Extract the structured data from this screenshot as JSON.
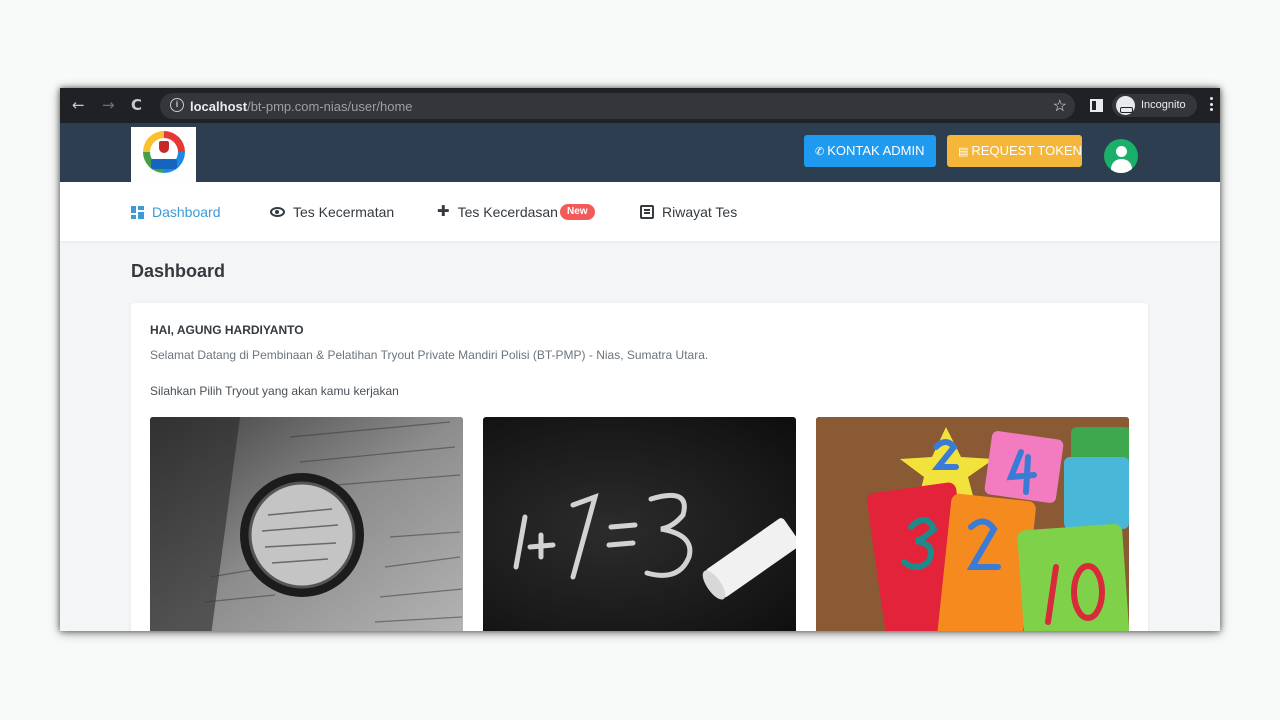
{
  "browser": {
    "back_icon": "arrow-left-icon",
    "forward_icon": "arrow-right-icon",
    "reload_icon": "reload-icon",
    "url_host": "localhost",
    "url_path": "/bt-pmp.com-nias/user/home",
    "mode_label": "Incognito"
  },
  "header": {
    "contact_admin_label": "KONTAK ADMIN",
    "request_token_label": "REQUEST TOKEN",
    "colors": {
      "bar": "#2c3e50",
      "admin": "#1e9bf0",
      "token": "#f5b73b",
      "avatar": "#1aaf6a"
    }
  },
  "menu": {
    "items": [
      {
        "label": "Dashboard",
        "icon": "dashboard-icon",
        "active": true
      },
      {
        "label": "Tes Kecermatan",
        "icon": "eye-icon",
        "active": false
      },
      {
        "label": "Tes Kecerdasan",
        "icon": "puzzle-icon",
        "active": false,
        "badge": "New"
      },
      {
        "label": "Riwayat Tes",
        "icon": "book-icon",
        "active": false
      }
    ]
  },
  "main": {
    "title": "Dashboard",
    "greeting": "HAI, AGUNG HARDIYANTO",
    "welcome": "Selamat Datang di Pembinaan & Pelatihan Tryout Private Mandiri Polisi (BT-PMP) - Nias, Sumatra Utara.",
    "prompt": "Silahkan Pilih Tryout yang akan kamu kerjakan"
  }
}
